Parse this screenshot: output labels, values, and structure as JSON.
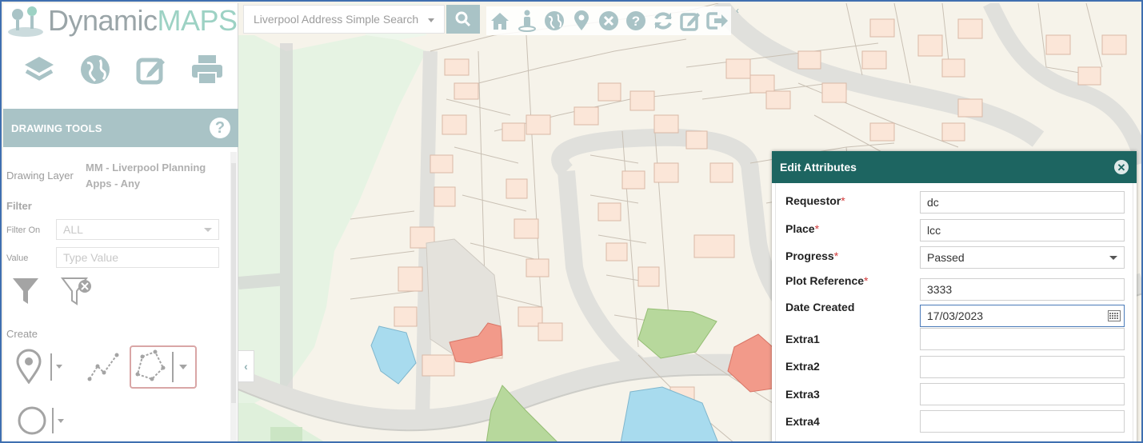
{
  "app": {
    "brand_left": "Dynamic",
    "brand_right": "MAPS"
  },
  "search": {
    "placeholder": "Liverpool Address Simple Search"
  },
  "toolbar": {
    "icons": [
      "home-icon",
      "street-view-icon",
      "globe-icon",
      "map-marker-icon",
      "clear-icon",
      "help-icon",
      "refresh-icon",
      "edit-icon",
      "logout-icon"
    ]
  },
  "sidebar": {
    "main_icons": [
      "layers-icon",
      "globe-icon",
      "edit-icon",
      "print-icon"
    ],
    "panel_title": "DRAWING TOOLS",
    "drawing_layer_label": "Drawing Layer",
    "drawing_layer_value": "MM - Liverpool Planning Apps - Any",
    "filter_heading": "Filter",
    "filter_on_label": "Filter On",
    "filter_on_value": "ALL",
    "value_label": "Value",
    "value_placeholder": "Type Value",
    "create_heading": "Create"
  },
  "edit_attributes": {
    "title": "Edit Attributes",
    "required_mark": "*",
    "fields": [
      {
        "label": "Requestor",
        "value": "dc",
        "required": true
      },
      {
        "label": "Place",
        "value": "lcc",
        "required": true
      },
      {
        "label": "Progress",
        "value": "Passed",
        "required": true
      },
      {
        "label": "Plot Reference",
        "value": "3333",
        "required": true
      },
      {
        "label": "Date Created",
        "value": "17/03/2023",
        "required": false
      },
      {
        "label": "Extra1",
        "value": "",
        "required": false
      },
      {
        "label": "Extra2",
        "value": "",
        "required": false
      },
      {
        "label": "Extra3",
        "value": "",
        "required": false
      },
      {
        "label": "Extra4",
        "value": "",
        "required": false
      }
    ]
  },
  "colors": {
    "accent": "#a9c3c6",
    "panel_header": "#1d6561",
    "required": "#d23a3a",
    "polygon_blue": "#a8dbee",
    "polygon_red": "#f29a8a",
    "polygon_green": "#b7d89c"
  }
}
